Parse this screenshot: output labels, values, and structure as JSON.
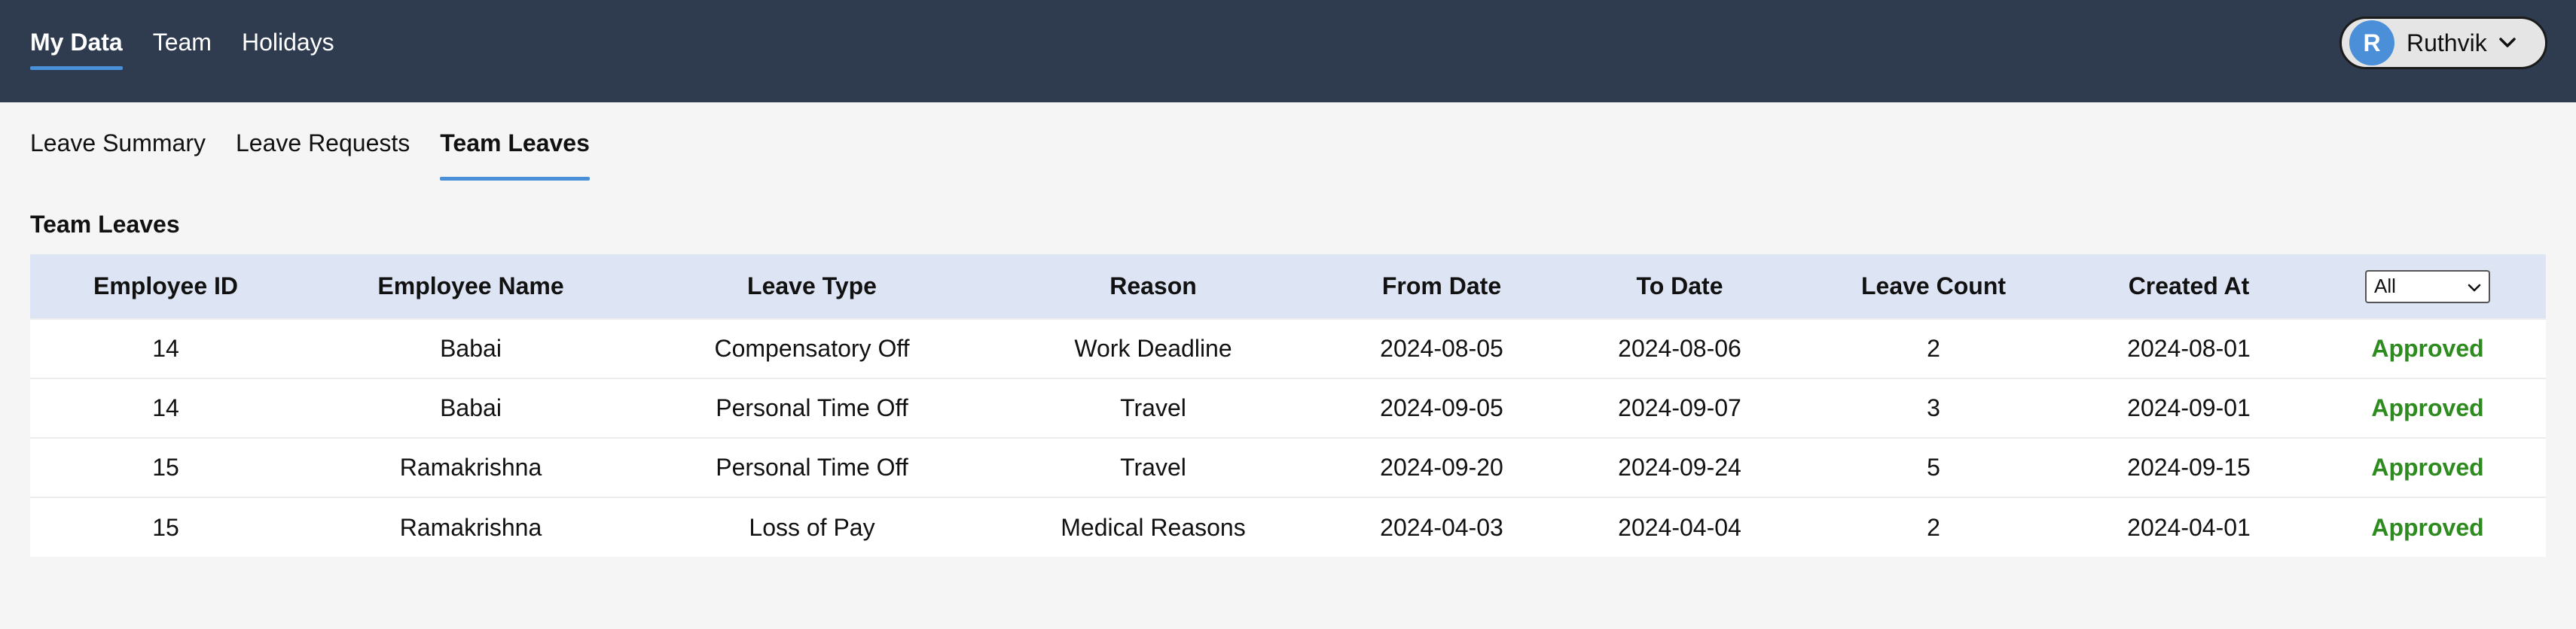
{
  "topnav": {
    "items": [
      {
        "label": "My Data",
        "active": true
      },
      {
        "label": "Team",
        "active": false
      },
      {
        "label": "Holidays",
        "active": false
      }
    ]
  },
  "user": {
    "initial": "R",
    "name": "Ruthvik",
    "avatar_color": "#4a8fd8"
  },
  "subtabs": {
    "items": [
      {
        "label": "Leave Summary",
        "active": false
      },
      {
        "label": "Leave Requests",
        "active": false
      },
      {
        "label": "Team Leaves",
        "active": true
      }
    ]
  },
  "section": {
    "title": "Team Leaves"
  },
  "table": {
    "headers": [
      "Employee ID",
      "Employee Name",
      "Leave Type",
      "Reason",
      "From Date",
      "To Date",
      "Leave Count",
      "Created At"
    ],
    "filter": {
      "selected": "All"
    },
    "rows": [
      {
        "employee_id": "14",
        "employee_name": "Babai",
        "leave_type": "Compensatory Off",
        "reason": "Work Deadline",
        "from_date": "2024-08-05",
        "to_date": "2024-08-06",
        "leave_count": "2",
        "created_at": "2024-08-01",
        "status": "Approved"
      },
      {
        "employee_id": "14",
        "employee_name": "Babai",
        "leave_type": "Personal Time Off",
        "reason": "Travel",
        "from_date": "2024-09-05",
        "to_date": "2024-09-07",
        "leave_count": "3",
        "created_at": "2024-09-01",
        "status": "Approved"
      },
      {
        "employee_id": "15",
        "employee_name": "Ramakrishna",
        "leave_type": "Personal Time Off",
        "reason": "Travel",
        "from_date": "2024-09-20",
        "to_date": "2024-09-24",
        "leave_count": "5",
        "created_at": "2024-09-15",
        "status": "Approved"
      },
      {
        "employee_id": "15",
        "employee_name": "Ramakrishna",
        "leave_type": "Loss of Pay",
        "reason": "Medical Reasons",
        "from_date": "2024-04-03",
        "to_date": "2024-04-04",
        "leave_count": "2",
        "created_at": "2024-04-01",
        "status": "Approved"
      }
    ]
  },
  "colors": {
    "topbar": "#2f3b4e",
    "accent": "#4a90d9",
    "header_row": "#dde5f5",
    "approved": "#2e8b1f"
  }
}
